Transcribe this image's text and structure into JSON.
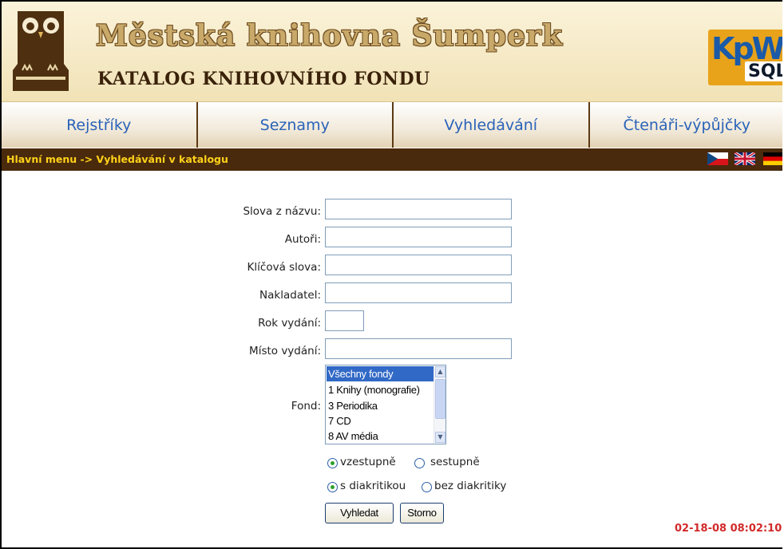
{
  "header": {
    "title": "Městská knihovna Šumperk",
    "subtitle": "KATALOG KNIHOVNÍHO FONDU",
    "logo_top": "KpWin",
    "logo_bottom": "SQL"
  },
  "nav": {
    "items": [
      "Rejstříky",
      "Seznamy",
      "Vyhledávání",
      "Čtenáři-výpůjčky"
    ]
  },
  "breadcrumb": "Hlavní menu -> Vyhledávání v katalogu",
  "form": {
    "title_label": "Slova z názvu:",
    "authors_label": "Autoři:",
    "keywords_label": "Klíčová slova:",
    "publisher_label": "Nakladatel:",
    "year_label": "Rok vydání:",
    "place_label": "Místo vydání:",
    "fond_label": "Fond:",
    "fond_options": [
      "Všechny fondy",
      "1 Knihy (monografie)",
      "3 Periodika",
      "7 CD",
      "8 AV média"
    ],
    "fond_selected": "Všechny fondy",
    "sort_asc": "vzestupně",
    "sort_desc": "sestupně",
    "diac_with": "s diakritikou",
    "diac_without": "bez diakritiky",
    "search_button": "Vyhledat",
    "cancel_button": "Storno"
  },
  "timestamp": "02-18-08 08:02:10",
  "colors": {
    "nav_link": "#2a63b8",
    "breadcrumb_bg": "#4a2a0c",
    "breadcrumb_text": "#ffd21a",
    "timestamp": "#d22a2a",
    "listbox_selected": "#3169c6"
  }
}
